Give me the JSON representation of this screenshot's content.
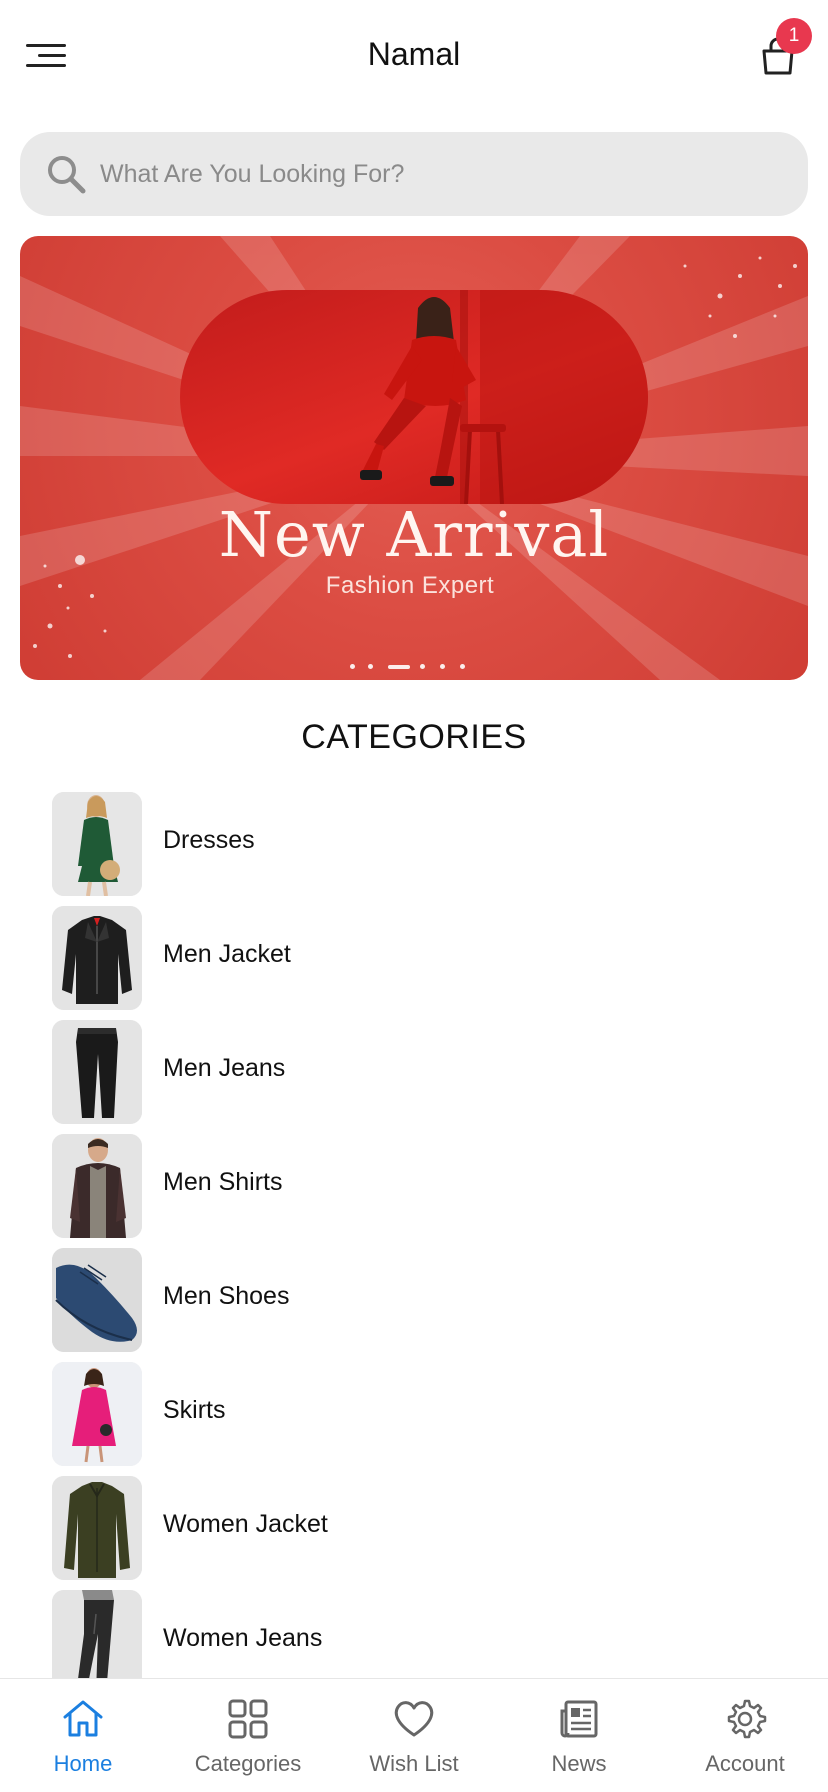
{
  "header": {
    "title": "Namal",
    "cart_count": "1",
    "menu_icon": "hamburger-menu-icon",
    "cart_icon": "shopping-bag-icon"
  },
  "search": {
    "placeholder": "What Are You Looking For?",
    "value": ""
  },
  "banner": {
    "title": "New Arrival",
    "subtitle": "Fashion Expert",
    "slide_count": 6,
    "active_slide": 3,
    "background_color": "#db4c42"
  },
  "categories": {
    "heading": "CATEGORIES",
    "items": [
      {
        "label": "Dresses"
      },
      {
        "label": "Men Jacket"
      },
      {
        "label": "Men Jeans"
      },
      {
        "label": "Men Shirts"
      },
      {
        "label": "Men Shoes"
      },
      {
        "label": "Skirts"
      },
      {
        "label": "Women Jacket"
      },
      {
        "label": "Women Jeans"
      }
    ]
  },
  "bottom_nav": {
    "active_color": "#1b7fe0",
    "inactive_color": "#666666",
    "items": [
      {
        "label": "Home",
        "icon": "home-icon",
        "active": true
      },
      {
        "label": "Categories",
        "icon": "grid-icon",
        "active": false
      },
      {
        "label": "Wish List",
        "icon": "heart-icon",
        "active": false
      },
      {
        "label": "News",
        "icon": "newspaper-icon",
        "active": false
      },
      {
        "label": "Account",
        "icon": "gear-icon",
        "active": false
      }
    ]
  }
}
